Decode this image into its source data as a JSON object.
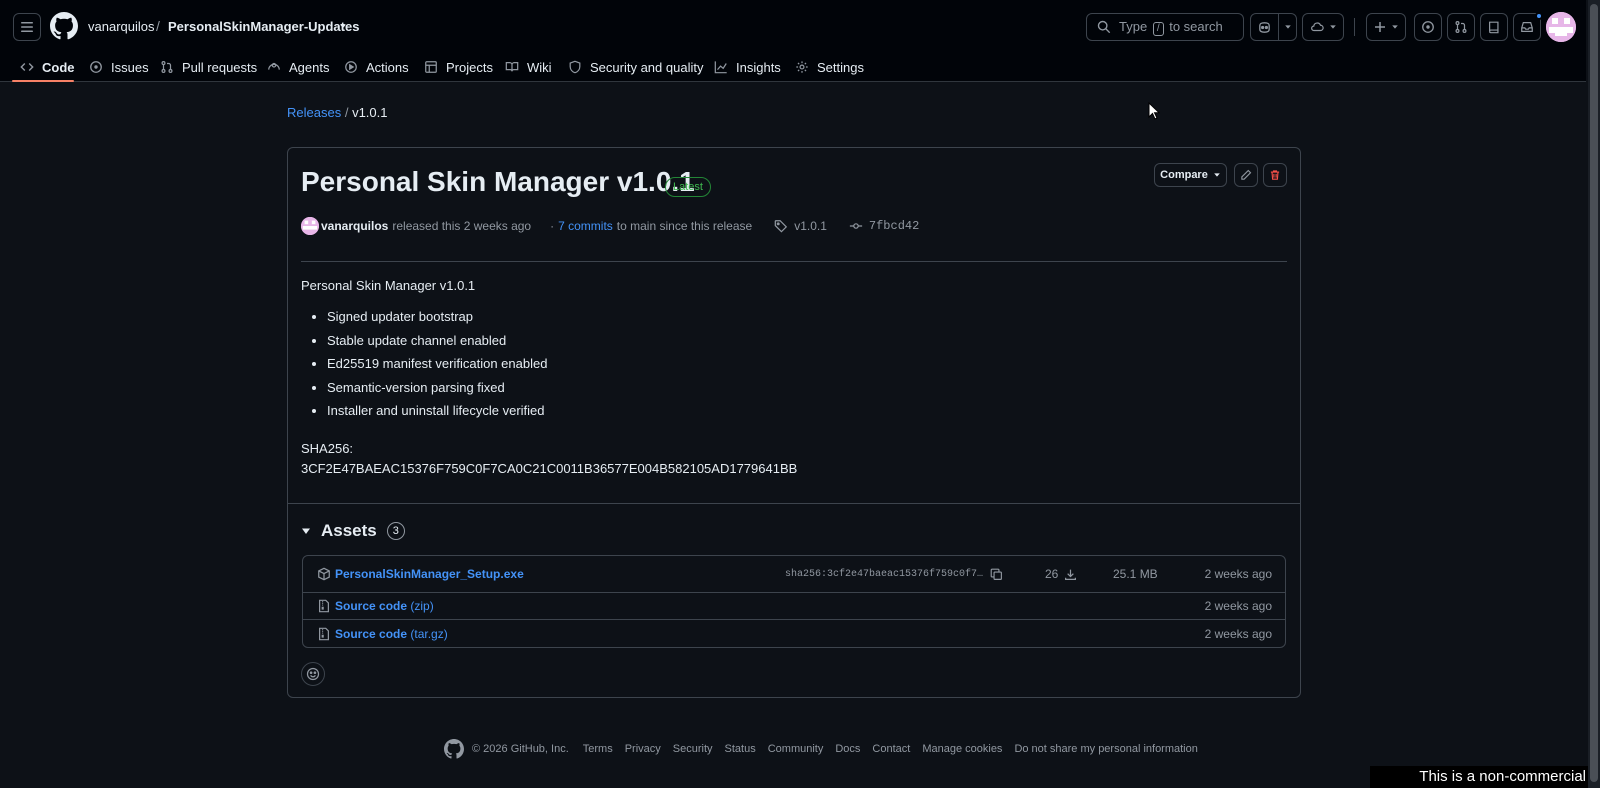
{
  "header": {
    "owner": "vanarquilos",
    "separator": "/",
    "repo": "PersonalSkinManager-Updates",
    "search_prefix": "Type",
    "search_key": "/",
    "search_suffix": "to search"
  },
  "tabs": [
    {
      "label": "Code",
      "icon": "code-icon",
      "active": true
    },
    {
      "label": "Issues",
      "icon": "issue-icon"
    },
    {
      "label": "Pull requests",
      "icon": "pull-request-icon"
    },
    {
      "label": "Agents",
      "icon": "agent-icon"
    },
    {
      "label": "Actions",
      "icon": "play-icon"
    },
    {
      "label": "Projects",
      "icon": "table-icon"
    },
    {
      "label": "Wiki",
      "icon": "book-icon"
    },
    {
      "label": "Security and quality",
      "icon": "shield-icon"
    },
    {
      "label": "Insights",
      "icon": "graph-icon"
    },
    {
      "label": "Settings",
      "icon": "gear-icon"
    }
  ],
  "breadcrumb": {
    "releases": "Releases",
    "sep": "/",
    "current": "v1.0.1"
  },
  "release": {
    "title": "Personal Skin Manager v1.0.1",
    "badge": "Latest",
    "compare_label": "Compare",
    "author": "vanarquilos",
    "released_text": "released this 2 weeks ago",
    "dot": "·",
    "commits_link": "7 commits",
    "commits_suffix": "to main since this release",
    "tag": "v1.0.1",
    "commit": "7fbcd42",
    "body_heading": "Personal Skin Manager v1.0.1",
    "notes": [
      "Signed updater bootstrap",
      "Stable update channel enabled",
      "Ed25519 manifest verification enabled",
      "Semantic-version parsing fixed",
      "Installer and uninstall lifecycle verified"
    ],
    "sha_label": "SHA256:",
    "sha_value": "3CF2E47BAEAC15376F759C0F7CA0C21C0011B36577E004B582105AD1779641BB"
  },
  "assets": {
    "title": "Assets",
    "count": "3",
    "items": [
      {
        "name": "PersonalSkinManager_Setup.exe",
        "hash": "sha256:3cf2e47baeac15376f759c0f7…",
        "downloads": "26",
        "size": "25.1 MB",
        "date": "2 weeks ago"
      },
      {
        "name": "Source code",
        "suffix": "(zip)",
        "date": "2 weeks ago"
      },
      {
        "name": "Source code",
        "suffix": "(tar.gz)",
        "date": "2 weeks ago"
      }
    ]
  },
  "footer": {
    "copyright": "© 2026 GitHub, Inc.",
    "links": [
      "Terms",
      "Privacy",
      "Security",
      "Status",
      "Community",
      "Docs",
      "Contact",
      "Manage cookies",
      "Do not share my personal information"
    ]
  },
  "watermark": "This is a non-commercial session.",
  "colors": {
    "accent": "#4493f8",
    "tab_underline": "#f78166",
    "latest_badge": "#3fb950",
    "background": "#0d1117"
  }
}
